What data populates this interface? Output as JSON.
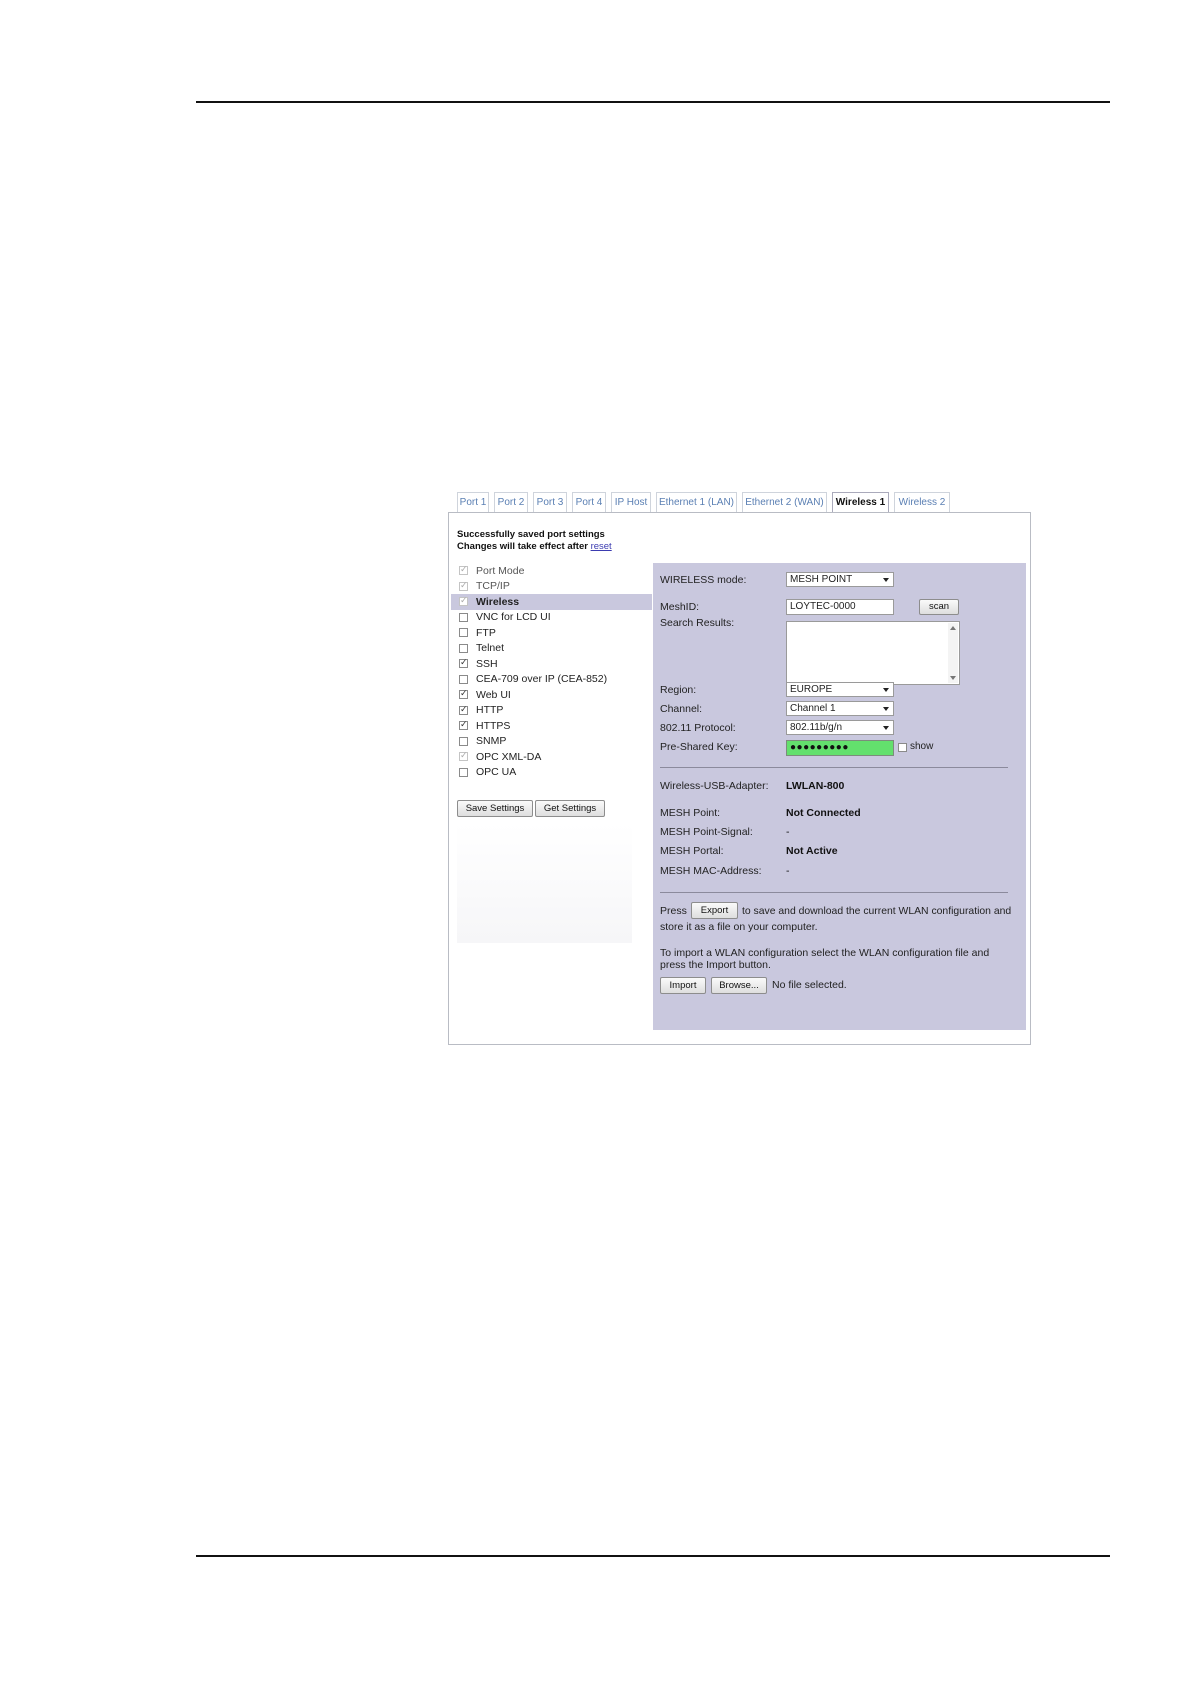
{
  "tabs": [
    "Port 1",
    "Port 2",
    "Port 3",
    "Port 4",
    "IP Host",
    "Ethernet 1 (LAN)",
    "Ethernet 2 (WAN)",
    "Wireless 1",
    "Wireless 2"
  ],
  "active_tab": "Wireless 1",
  "status": {
    "line1": "Successfully saved port settings",
    "line2_prefix": "Changes will take effect after",
    "reset_link": "reset"
  },
  "left_items": [
    {
      "label": "Port Mode",
      "checked": true,
      "grey": true
    },
    {
      "label": "TCP/IP",
      "checked": true,
      "grey": true
    },
    {
      "label": "Wireless",
      "checked": true,
      "grey": true,
      "selected": true
    },
    {
      "label": "VNC for LCD UI",
      "checked": false
    },
    {
      "label": "FTP",
      "checked": false
    },
    {
      "label": "Telnet",
      "checked": false
    },
    {
      "label": "SSH",
      "checked": true
    },
    {
      "label": "CEA-709 over IP (CEA-852)",
      "checked": false
    },
    {
      "label": "Web UI",
      "checked": true
    },
    {
      "label": "HTTP",
      "checked": true
    },
    {
      "label": "HTTPS",
      "checked": true
    },
    {
      "label": "SNMP",
      "checked": false
    },
    {
      "label": "OPC XML-DA",
      "checked": true,
      "grey": true
    },
    {
      "label": "OPC UA",
      "checked": false
    }
  ],
  "buttons": {
    "save_settings": "Save Settings",
    "get_settings": "Get Settings",
    "scan": "scan",
    "export": "Export",
    "import": "Import",
    "browse": "Browse..."
  },
  "wireless": {
    "mode_label": "WIRELESS mode:",
    "mode_value": "MESH POINT",
    "meshid_label": "MeshID:",
    "meshid_value": "LOYTEC-0000",
    "search_results_label": "Search Results:",
    "region_label": "Region:",
    "region_value": "EUROPE",
    "channel_label": "Channel:",
    "channel_value": "Channel 1",
    "protocol_label": "802.11 Protocol:",
    "protocol_value": "802.11b/g/n",
    "psk_label": "Pre-Shared Key:",
    "psk_value": "●●●●●●●●●",
    "show_label": "show"
  },
  "status_info": {
    "adapter_label": "Wireless-USB-Adapter:",
    "adapter_value": "LWLAN-800",
    "mesh_point_label": "MESH Point:",
    "mesh_point_value": "Not Connected",
    "signal_label": "MESH Point-Signal:",
    "signal_value": "-",
    "portal_label": "MESH Portal:",
    "portal_value": "Not Active",
    "mac_label": "MESH MAC-Address:",
    "mac_value": "-"
  },
  "export_text": {
    "press": "Press",
    "after_export_line1": "to save and download the current WLAN configuration and",
    "line2": "store it as a file on your computer."
  },
  "import_text": {
    "line1": "To import a WLAN configuration select the WLAN configuration file and",
    "line2": "press the Import button.",
    "no_file": "No file selected."
  }
}
